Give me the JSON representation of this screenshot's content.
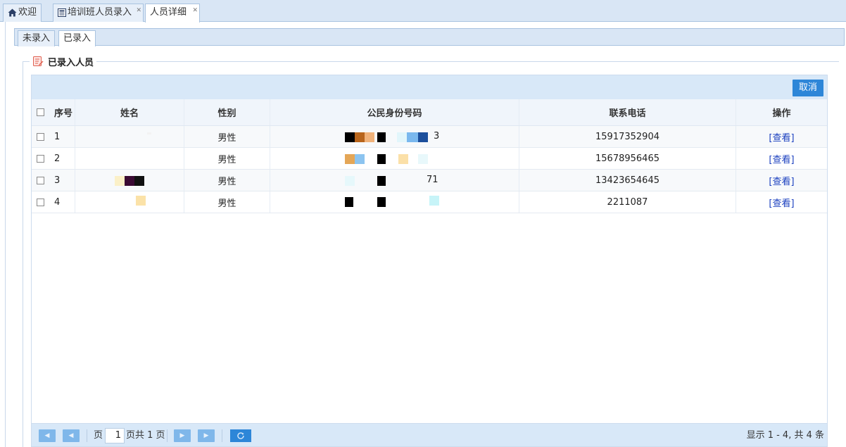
{
  "top_tabs": [
    {
      "label": "欢迎",
      "icon": "home-icon",
      "closable": false
    },
    {
      "label": "培训班人员录入",
      "icon": "page-icon",
      "closable": true
    },
    {
      "label": "人员详细",
      "icon": "",
      "closable": true,
      "active": true
    }
  ],
  "inner_tabs": [
    {
      "label": "未录入"
    },
    {
      "label": "已录入",
      "active": true
    }
  ],
  "panel": {
    "title": "已录入人员",
    "icon": "edit-icon"
  },
  "toolbar": {
    "cancel_label": "取消"
  },
  "table": {
    "headers": {
      "no": "序号",
      "name": "姓名",
      "sex": "性别",
      "id": "公民身份号码",
      "tel": "联系电话",
      "op": "操作"
    },
    "rows": [
      {
        "no": "1",
        "name_visible": "",
        "sex": "男性",
        "id_visible": "3",
        "tel": "15917352904",
        "op": "[查看]"
      },
      {
        "no": "2",
        "name_visible": "",
        "sex": "男性",
        "id_visible": "",
        "tel": "15678956465",
        "op": "[查看]"
      },
      {
        "no": "3",
        "name_visible": "",
        "sex": "男性",
        "id_visible": "71",
        "tel": "13423654645",
        "op": "[查看]"
      },
      {
        "no": "4",
        "name_visible": "",
        "sex": "男性",
        "id_visible": "",
        "tel": "2211087",
        "op": "[查看]"
      }
    ]
  },
  "pager": {
    "page_label": "页",
    "page_value": "1",
    "total_label": "页共 1 页",
    "info": "显示 1 - 4, 共 4 条"
  },
  "colors": {
    "accent": "#2d86d8",
    "link": "#1a3fbf",
    "toolbar_bg": "#d8e8f8"
  }
}
